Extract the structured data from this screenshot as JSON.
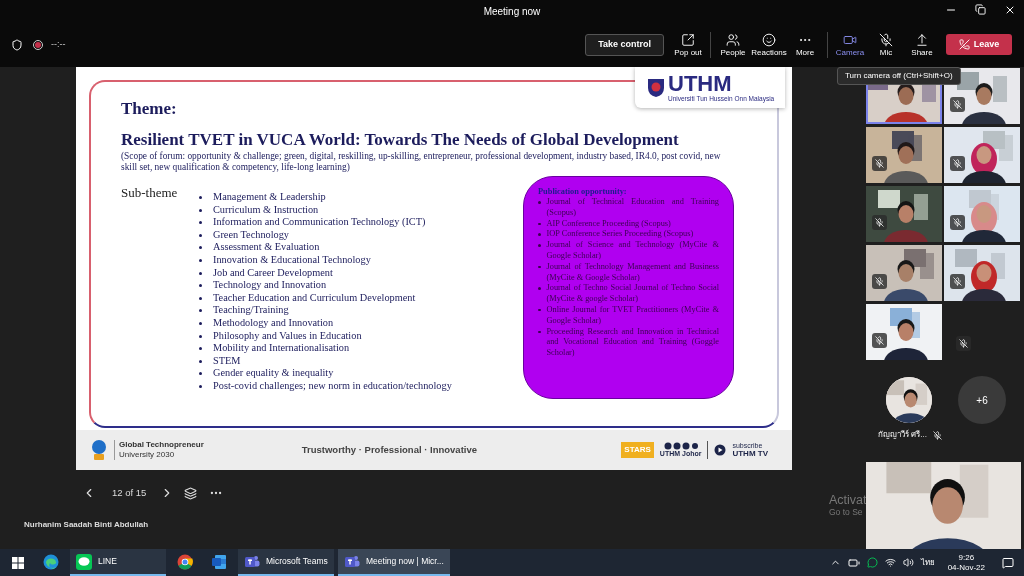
{
  "window": {
    "title": "Meeting now"
  },
  "toolbar": {
    "timer": "--:--",
    "take_control": "Take control",
    "buttons": [
      {
        "kind": "popout",
        "label": "Pop out",
        "active": false
      },
      {
        "kind": "people",
        "label": "People",
        "active": false
      },
      {
        "kind": "reactions",
        "label": "Reactions",
        "active": false
      },
      {
        "kind": "more",
        "label": "More",
        "active": false
      },
      {
        "kind": "camera",
        "label": "Camera",
        "active": true
      },
      {
        "kind": "mic",
        "label": "Mic",
        "active": false,
        "muted": true
      },
      {
        "kind": "share",
        "label": "Share",
        "active": false
      }
    ],
    "leave": "Leave",
    "tooltip": "Turn camera off (Ctrl+Shift+O)"
  },
  "slide": {
    "logo": {
      "name": "UTHM",
      "subtitle": "Universiti Tun Hussein Onn Malaysia"
    },
    "theme_label": "Theme:",
    "title": "Resilient TVET in VUCA World: Towards The Needs of Global Development",
    "scope": "(Scope of forum: opportunity & challenge; green, digital, reskilling, up-skilling, entrepreneur, professional development, industry based, IR4.0, post covid, new skill set, new qualification & competency, life-long learning)",
    "subtheme_label": "Sub-theme",
    "subthemes": [
      "Management & Leadership",
      "Curriculum & Instruction",
      "Information and Communication Technology (ICT)",
      "Green Technology",
      "Assessment & Evaluation",
      "Innovation & Educational Technology",
      "Job and Career Development",
      "Technology and Innovation",
      "Teacher Education and Curriculum Development",
      "Teaching/Training",
      "Methodology and Innovation",
      "Philosophy and Values in Education",
      "Mobility and Internationalisation",
      "STEM",
      "Gender equality & inequality",
      "Post-covid challenges; new norm in education/technology"
    ],
    "publication": {
      "heading": "Publication opportunity:",
      "items": [
        "Journal of Technical Education and Training (Scopus)",
        "AIP Conference Proceeding (Scopus)",
        "IOP Conference Series Proceeding (Scopus)",
        "Journal of Science and Technology (MyCite & Google Scholar)",
        "Journal of Technology Management and Business (MyCite & Google Scholar)",
        "Journal of Techno Social Journal of Techno Social (MyCite & google Scholar)",
        "Online Journal for TVET Practitioners (MyCite & Google Scholar)",
        "Proceeding Research and Innovation in Technical and Vocational Education and Training (Goggle Scholar)"
      ]
    },
    "footer": {
      "brand_line1": "Global Technopreneur",
      "brand_line2": "University 2030",
      "motto": "Trustworthy · Professional · Innovative",
      "stars": "STARS",
      "social": "UTHM Johor",
      "subscribe": "subscribe",
      "channel": "UTHM TV"
    }
  },
  "slide_nav": {
    "page": "12 of 15"
  },
  "presenter": "Nurhanim Saadah Binti Abdullah",
  "participants": {
    "tiles": [
      {
        "kind": "video",
        "speaking": true,
        "muted": false
      },
      {
        "kind": "video",
        "speaking": false,
        "muted": true
      },
      {
        "kind": "video",
        "speaking": false,
        "muted": true
      },
      {
        "kind": "video",
        "speaking": false,
        "muted": true
      },
      {
        "kind": "video",
        "speaking": false,
        "muted": true
      },
      {
        "kind": "video",
        "speaking": false,
        "muted": true
      },
      {
        "kind": "video",
        "speaking": false,
        "muted": true
      },
      {
        "kind": "video",
        "speaking": false,
        "muted": true
      },
      {
        "kind": "video",
        "speaking": false,
        "muted": true
      },
      {
        "kind": "empty",
        "speaking": false,
        "muted": true
      }
    ],
    "named": {
      "name": "กัญญาวีร์ ศรี...",
      "muted": true
    },
    "overflow": "+6"
  },
  "activation_notice": {
    "title": "Activat",
    "subtitle": "Go to Se"
  },
  "taskbar": {
    "apps": [
      {
        "kind": "edge",
        "running": false,
        "selected": false
      },
      {
        "kind": "line",
        "label": "LINE",
        "running": true,
        "selected": false
      },
      {
        "kind": "chrome",
        "running": false,
        "selected": false
      },
      {
        "kind": "word",
        "running": false,
        "selected": false
      },
      {
        "kind": "teams",
        "label": "Microsoft Teams",
        "running": true,
        "selected": false
      },
      {
        "kind": "teams",
        "label": "Meeting now | Micr...",
        "running": true,
        "selected": true
      }
    ],
    "language": "ไทย",
    "time": "9:26",
    "date": "04-Nov-22"
  }
}
